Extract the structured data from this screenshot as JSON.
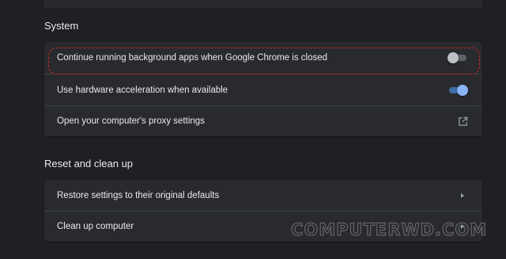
{
  "sections": {
    "system": {
      "title": "System",
      "rows": [
        {
          "label": "Continue running background apps when Google Chrome is closed",
          "control": "toggle",
          "state": "off"
        },
        {
          "label": "Use hardware acceleration when available",
          "control": "toggle",
          "state": "on"
        },
        {
          "label": "Open your computer's proxy settings",
          "control": "external-link-icon"
        }
      ]
    },
    "reset": {
      "title": "Reset and clean up",
      "rows": [
        {
          "label": "Restore settings to their original defaults",
          "control": "chevron-right-icon"
        },
        {
          "label": "Clean up computer",
          "control": "chevron-right-icon"
        }
      ]
    }
  },
  "watermark": "COMPUTERWD.COM",
  "colors": {
    "background": "#1f2023",
    "card": "#292a2d",
    "toggle_on": "#8ab4f8",
    "highlight": "#c62828"
  }
}
